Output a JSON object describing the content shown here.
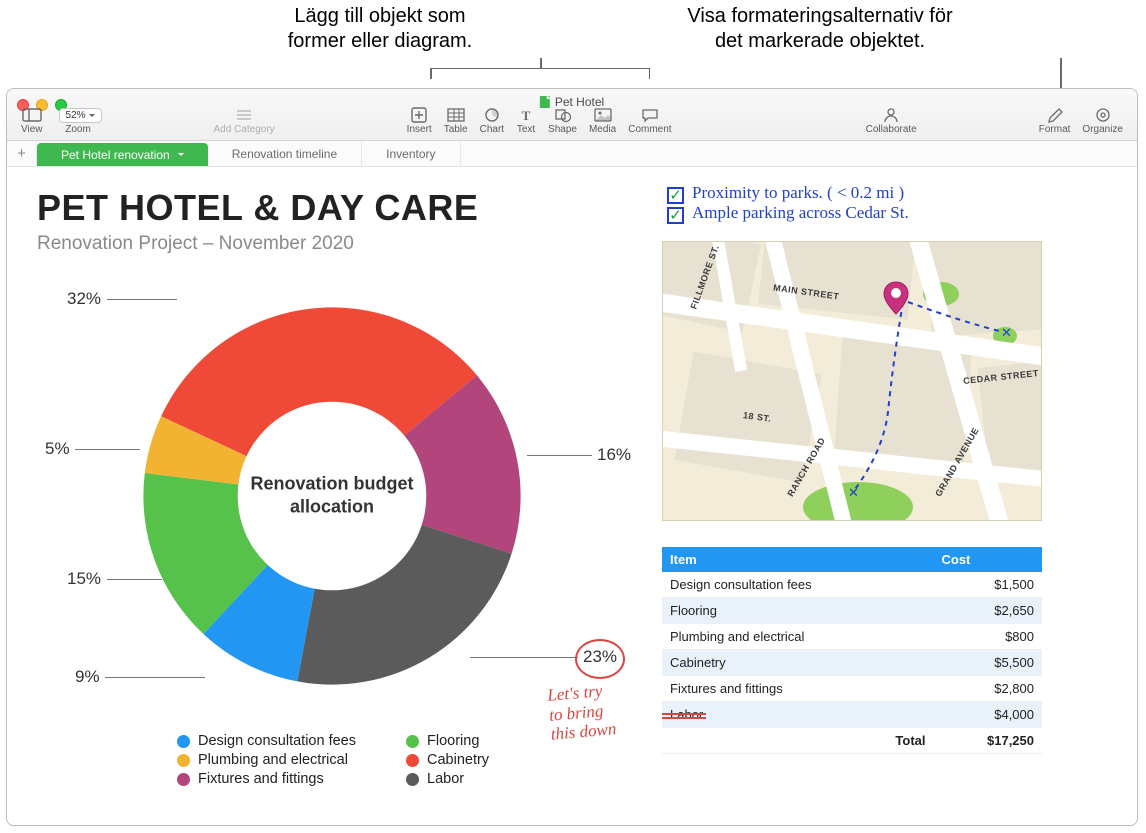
{
  "callouts": {
    "left": "Lägg till objekt som\nformer eller diagram.",
    "right": "Visa formateringsalternativ för\ndet markerade objektet."
  },
  "window": {
    "title": "Pet Hotel"
  },
  "toolbar": {
    "view": "View",
    "zoom_label": "Zoom",
    "zoom_value": "52%",
    "add_category": "Add Category",
    "insert": "Insert",
    "table": "Table",
    "chart": "Chart",
    "text": "Text",
    "shape": "Shape",
    "media": "Media",
    "comment": "Comment",
    "collaborate": "Collaborate",
    "format": "Format",
    "organize": "Organize"
  },
  "sheets": {
    "active": "Pet Hotel renovation",
    "tab2": "Renovation timeline",
    "tab3": "Inventory"
  },
  "doc": {
    "title": "PET HOTEL & DAY CARE",
    "subtitle": "Renovation Project – November 2020"
  },
  "chart_data": {
    "type": "pie",
    "title": "Renovation budget allocation",
    "series": [
      {
        "name": "Design consultation fees",
        "value": 9,
        "color": "#2196f2"
      },
      {
        "name": "Flooring",
        "value": 15,
        "color": "#56c14b"
      },
      {
        "name": "Plumbing and electrical",
        "value": 5,
        "color": "#f2b332"
      },
      {
        "name": "Cabinetry",
        "value": 32,
        "color": "#ef4937"
      },
      {
        "name": "Fixtures and fittings",
        "value": 16,
        "color": "#b1457c"
      },
      {
        "name": "Labor",
        "value": 23,
        "color": "#5b5b5b"
      }
    ],
    "labels": {
      "p32": "32%",
      "p5": "5%",
      "p15": "15%",
      "p9": "9%",
      "p16": "16%",
      "p23": "23%"
    }
  },
  "annotation": {
    "note": "Let's try\nto bring\nthis down"
  },
  "checklist": {
    "i1": "Proximity to parks. ( < 0.2 mi )",
    "i2": "Ample parking across  Cedar St."
  },
  "map_labels": {
    "fillmore": "FILLMORE ST.",
    "main": "MAIN STREET",
    "ranch": "RANCH ROAD",
    "grand": "GRAND AVENUE",
    "cedar": "CEDAR STREET",
    "n18": "18 ST."
  },
  "table": {
    "h_item": "Item",
    "h_cost": "Cost",
    "rows": [
      {
        "item": "Design consultation fees",
        "cost": "$1,500"
      },
      {
        "item": "Flooring",
        "cost": "$2,650"
      },
      {
        "item": "Plumbing and electrical",
        "cost": "$800"
      },
      {
        "item": "Cabinetry",
        "cost": "$5,500"
      },
      {
        "item": "Fixtures and fittings",
        "cost": "$2,800"
      },
      {
        "item": "Labor",
        "cost": "$4,000"
      }
    ],
    "total_label": "Total",
    "total_value": "$17,250"
  },
  "legend": {
    "i0": "Design consultation fees",
    "i1": "Flooring",
    "i2": "Plumbing and electrical",
    "i3": "Cabinetry",
    "i4": "Fixtures and fittings",
    "i5": "Labor"
  }
}
